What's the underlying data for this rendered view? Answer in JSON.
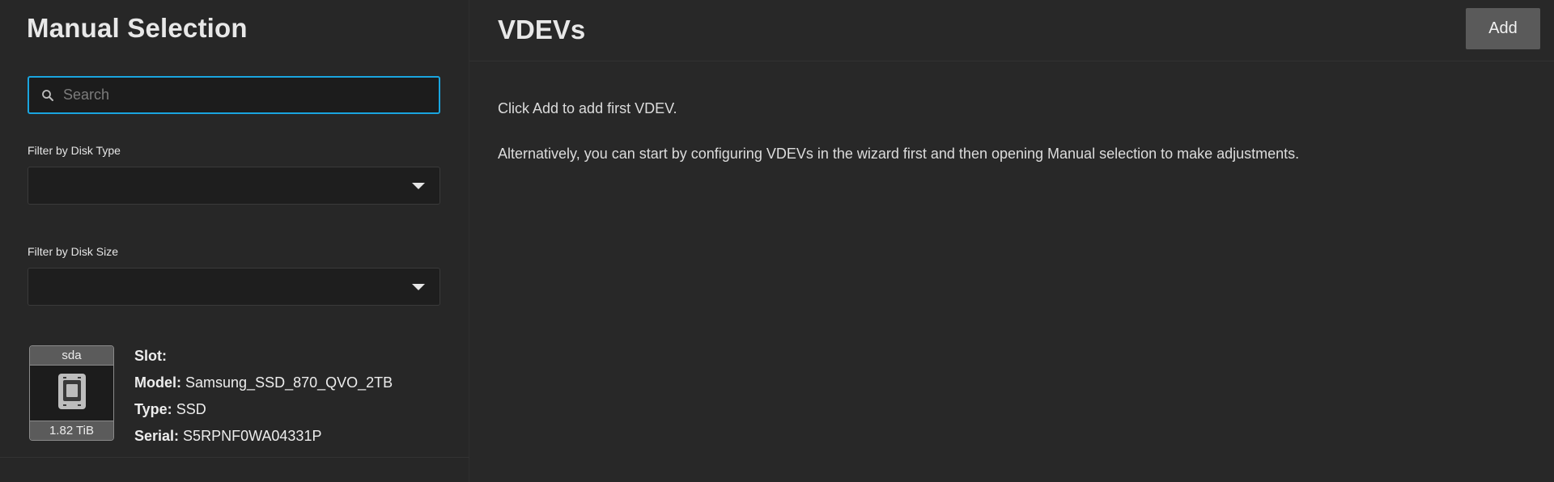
{
  "left": {
    "title": "Manual Selection",
    "search": {
      "placeholder": "Search",
      "value": ""
    },
    "filter_disk_type": {
      "label": "Filter by Disk Type",
      "value": ""
    },
    "filter_disk_size": {
      "label": "Filter by Disk Size",
      "value": ""
    },
    "disks": [
      {
        "name": "sda",
        "size": "1.82 TiB",
        "slot_key": "Slot:",
        "slot_value": "",
        "model_key": "Model:",
        "model_value": "Samsung_SSD_870_QVO_2TB",
        "type_key": "Type:",
        "type_value": "SSD",
        "serial_key": "Serial:",
        "serial_value": "S5RPNF0WA04331P",
        "icon": "ssd-icon"
      }
    ]
  },
  "right": {
    "title": "VDEVs",
    "add_label": "Add",
    "message_1": "Click Add to add first VDEV.",
    "message_2": "Alternatively, you can start by configuring VDEVs in the wizard first and then opening Manual selection to make adjustments."
  },
  "colors": {
    "accent": "#1aa5df",
    "background": "#282828",
    "button": "#5a5a5a"
  }
}
